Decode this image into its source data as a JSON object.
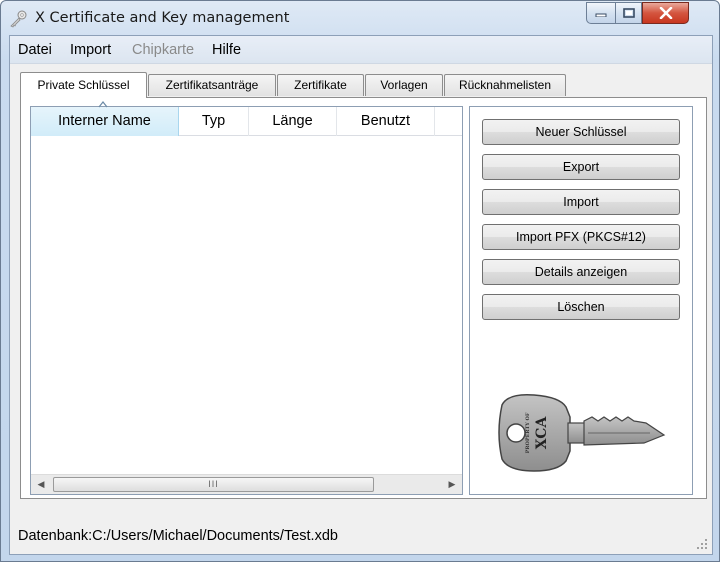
{
  "window": {
    "title": "X Certificate and Key management",
    "accent_close": "#c8361f"
  },
  "menu": {
    "items": [
      {
        "label": "Datei",
        "enabled": true
      },
      {
        "label": "Import",
        "enabled": true
      },
      {
        "label": "Chipkarte",
        "enabled": false
      },
      {
        "label": "Hilfe",
        "enabled": true
      }
    ]
  },
  "tabs": [
    {
      "label": "Private Schlüssel",
      "active": true
    },
    {
      "label": "Zertifikatsanträge",
      "active": false
    },
    {
      "label": "Zertifikate",
      "active": false
    },
    {
      "label": "Vorlagen",
      "active": false
    },
    {
      "label": "Rücknahmelisten",
      "active": false
    }
  ],
  "keylist": {
    "columns": [
      "Interner Name",
      "Typ",
      "Länge",
      "Benutzt"
    ],
    "sorted_column": "Interner Name",
    "rows": [],
    "scroll_thumb_grip": "III"
  },
  "actions": [
    "Neuer Schlüssel",
    "Export",
    "Import",
    "Import PFX (PKCS#12)",
    "Details anzeigen",
    "Löschen"
  ],
  "key_image": {
    "text_large": "XCA",
    "text_small": "PROPERTY OF"
  },
  "status": {
    "text": "Datenbank:C:/Users/Michael/Documents/Test.xdb"
  }
}
